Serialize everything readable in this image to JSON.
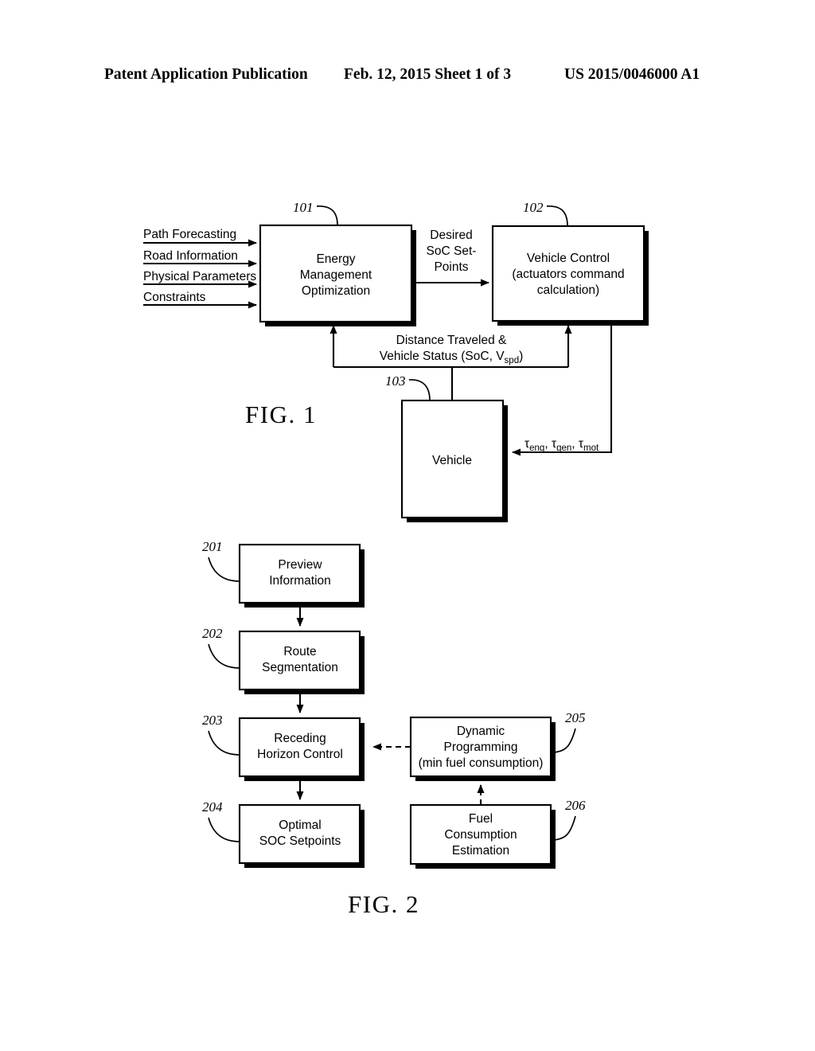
{
  "header": {
    "left": "Patent Application Publication",
    "middle": "Feb. 12, 2015  Sheet 1 of 3",
    "right": "US 2015/0046000 A1"
  },
  "figure1": {
    "caption": "FIG. 1",
    "inputs": [
      {
        "label": "Path Forecasting"
      },
      {
        "label": "Road Information"
      },
      {
        "label": "Physical Parameters"
      },
      {
        "label": "Constraints"
      }
    ],
    "blocks": [
      {
        "ref": "101",
        "name": "energy-management-optimization",
        "lines": [
          "Energy",
          "Management",
          "Optimization"
        ]
      },
      {
        "ref": "102",
        "name": "vehicle-control",
        "lines": [
          "Vehicle Control",
          "(actuators command",
          "calculation)"
        ]
      },
      {
        "ref": "103",
        "name": "vehicle",
        "lines": [
          "Vehicle"
        ]
      }
    ],
    "signals": {
      "desired_soc": [
        "Desired",
        "SoC Set-",
        "Points"
      ],
      "feedback_line1": "Distance Traveled &",
      "feedback_line2_pre": "Vehicle Status (SoC, V",
      "feedback_line2_sub": "spd",
      "feedback_line2_post": ")",
      "torque_eng_sym": "τ",
      "torque_eng_sub": "eng",
      "torque_gen_sym": "τ",
      "torque_gen_sub": "gen",
      "torque_mot_sym": "τ",
      "torque_mot_sub": "mot",
      "torque_sep1": ", ",
      "torque_sep2": ", "
    }
  },
  "figure2": {
    "caption": "FIG. 2",
    "blocks": [
      {
        "ref": "201",
        "name": "preview-information",
        "lines": [
          "Preview",
          "Information"
        ]
      },
      {
        "ref": "202",
        "name": "route-segmentation",
        "lines": [
          "Route",
          "Segmentation"
        ]
      },
      {
        "ref": "203",
        "name": "receding-horizon-control",
        "lines": [
          "Receding",
          "Horizon Control"
        ]
      },
      {
        "ref": "204",
        "name": "optimal-soc-setpoints",
        "lines": [
          "Optimal",
          "SOC Setpoints"
        ]
      },
      {
        "ref": "205",
        "name": "dynamic-programming",
        "lines": [
          "Dynamic",
          "Programming",
          "(min fuel consumption)"
        ]
      },
      {
        "ref": "206",
        "name": "fuel-consumption-estimation",
        "lines": [
          "Fuel",
          "Consumption",
          "Estimation"
        ]
      }
    ]
  }
}
